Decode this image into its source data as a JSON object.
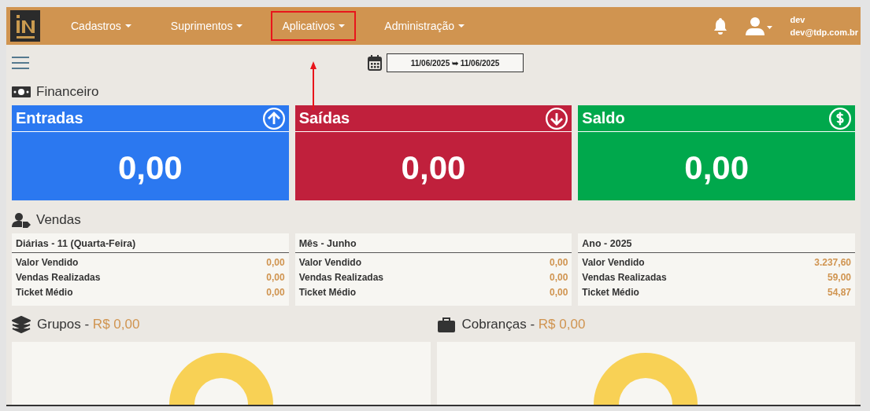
{
  "navbar": {
    "menu": [
      {
        "label": "Cadastros",
        "highlighted": false
      },
      {
        "label": "Suprimentos",
        "highlighted": false
      },
      {
        "label": "Aplicativos",
        "highlighted": true
      },
      {
        "label": "Administração",
        "highlighted": false
      }
    ],
    "user": {
      "name": "dev",
      "email": "dev@tdp.com.br"
    }
  },
  "date_range": {
    "value": "11/06/2025 ➥ 11/06/2025"
  },
  "financeiro": {
    "title": "Financeiro",
    "cards": [
      {
        "title": "Entradas",
        "kind": "in",
        "color": "#2b78f0",
        "value": "0,00"
      },
      {
        "title": "Saídas",
        "kind": "out",
        "color": "#c0203c",
        "value": "0,00"
      },
      {
        "title": "Saldo",
        "kind": "balance",
        "color": "#00a84c",
        "value": "0,00"
      }
    ]
  },
  "vendas": {
    "title": "Vendas",
    "tables": [
      {
        "title": "Diárias - 11 (Quarta-Feira)",
        "rows": [
          {
            "label": "Valor Vendido",
            "value": "0,00"
          },
          {
            "label": "Vendas Realizadas",
            "value": "0,00"
          },
          {
            "label": "Ticket Médio",
            "value": "0,00"
          }
        ]
      },
      {
        "title": "Mês - Junho",
        "rows": [
          {
            "label": "Valor Vendido",
            "value": "0,00"
          },
          {
            "label": "Vendas Realizadas",
            "value": "0,00"
          },
          {
            "label": "Ticket Médio",
            "value": "0,00"
          }
        ]
      },
      {
        "title": "Ano - 2025",
        "rows": [
          {
            "label": "Valor Vendido",
            "value": "3.237,60"
          },
          {
            "label": "Vendas Realizadas",
            "value": "59,00"
          },
          {
            "label": "Ticket Médio",
            "value": "54,87"
          }
        ]
      }
    ]
  },
  "panels": [
    {
      "kind": "layers",
      "title": "Grupos -",
      "amount": "R$ 0,00"
    },
    {
      "kind": "briefcase",
      "title": "Cobranças -",
      "amount": "R$ 0,00"
    }
  ]
}
